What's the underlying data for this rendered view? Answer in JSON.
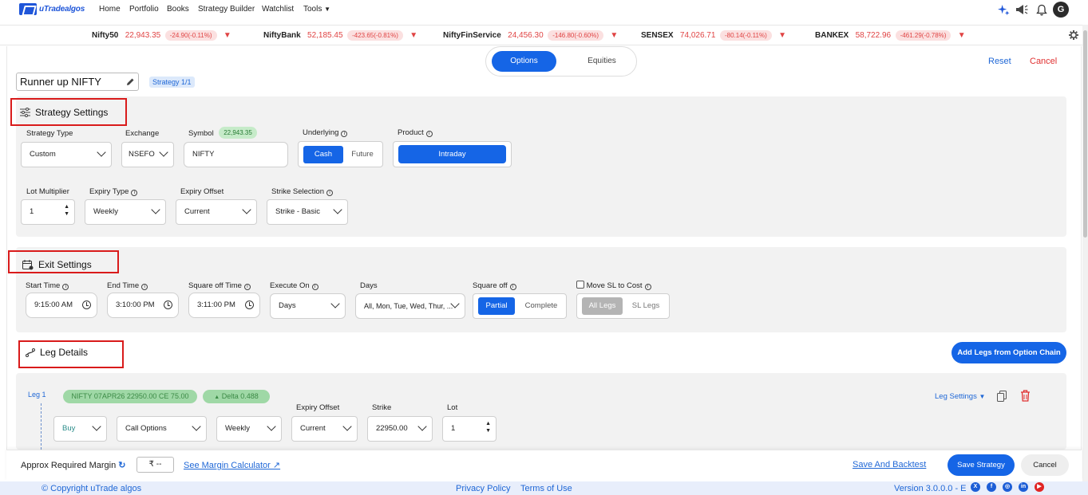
{
  "nav": {
    "logo_text": "uTradealgos",
    "items": [
      "Home",
      "Portfolio",
      "Books",
      "Strategy Builder",
      "Watchlist",
      "Tools"
    ],
    "avatar_initial": "G"
  },
  "ticker": [
    {
      "name": "Nifty50",
      "value": "22,943.35",
      "change": "-24.90(-0.11%)"
    },
    {
      "name": "NiftyBank",
      "value": "52,185.45",
      "change": "-423.65(-0.81%)"
    },
    {
      "name": "NiftyFinService",
      "value": "24,456.30",
      "change": "-146.80(-0.60%)"
    },
    {
      "name": "SENSEX",
      "value": "74,026.71",
      "change": "-80.14(-0.11%)"
    },
    {
      "name": "BANKEX",
      "value": "58,722.96",
      "change": "-461.29(-0.78%)"
    }
  ],
  "mode_toggle": {
    "options": "Options",
    "equities": "Equities"
  },
  "actions": {
    "reset": "Reset",
    "cancel": "Cancel"
  },
  "strategy": {
    "name": "Runner up NIFTY",
    "badge": "Strategy 1/1"
  },
  "strategy_settings": {
    "title": "Strategy Settings",
    "strategy_type_label": "Strategy Type",
    "strategy_type": "Custom",
    "exchange_label": "Exchange",
    "exchange": "NSEFO",
    "symbol_label": "Symbol",
    "symbol_price": "22,943.35",
    "symbol": "NIFTY",
    "underlying_label": "Underlying",
    "underlying_cash": "Cash",
    "underlying_future": "Future",
    "product_label": "Product",
    "product": "Intraday",
    "lot_multiplier_label": "Lot Multiplier",
    "lot_multiplier": "1",
    "expiry_type_label": "Expiry Type",
    "expiry_type": "Weekly",
    "expiry_offset_label": "Expiry Offset",
    "expiry_offset": "Current",
    "strike_selection_label": "Strike Selection",
    "strike_selection": "Strike - Basic"
  },
  "exit_settings": {
    "title": "Exit Settings",
    "start_time_label": "Start Time",
    "start_time": "9:15:00 AM",
    "end_time_label": "End Time",
    "end_time": "3:10:00 PM",
    "square_off_time_label": "Square off Time",
    "square_off_time": "3:11:00 PM",
    "execute_on_label": "Execute On",
    "execute_on": "Days",
    "days_label": "Days",
    "days": "All, Mon, Tue, Wed, Thur, ...",
    "square_off_label": "Square off",
    "square_off_partial": "Partial",
    "square_off_complete": "Complete",
    "move_sl_label": "Move SL to Cost",
    "all_legs": "All Legs",
    "sl_legs": "SL Legs"
  },
  "leg_details": {
    "title": "Leg Details",
    "add_legs_button": "Add Legs from Option Chain",
    "leg_label": "Leg 1",
    "contract": "NIFTY 07APR26 22950.00 CE 75.00",
    "delta": "Delta 0.488",
    "leg_settings": "Leg Settings",
    "side": "Buy",
    "option_type": "Call Options",
    "expiry_type": "Weekly",
    "expiry_offset_label": "Expiry Offset",
    "expiry_offset": "Current",
    "strike_label": "Strike",
    "strike": "22950.00",
    "lot_label": "Lot",
    "lot": "1"
  },
  "bottom": {
    "margin_label": "Approx Required Margin",
    "margin_value": "₹ --",
    "margin_calc": "See Margin Calculator ↗",
    "save_backtest": "Save And Backtest",
    "save_strategy": "Save Strategy",
    "cancel": "Cancel"
  },
  "footer": {
    "copyright": "© Copyright uTrade algos",
    "privacy": "Privacy Policy",
    "terms": "Terms of Use",
    "version": "Version 3.0.0.0 - E"
  },
  "colors": {
    "accent": "#1565e6",
    "danger": "#e03030",
    "success_bg": "#9fd8a6"
  }
}
